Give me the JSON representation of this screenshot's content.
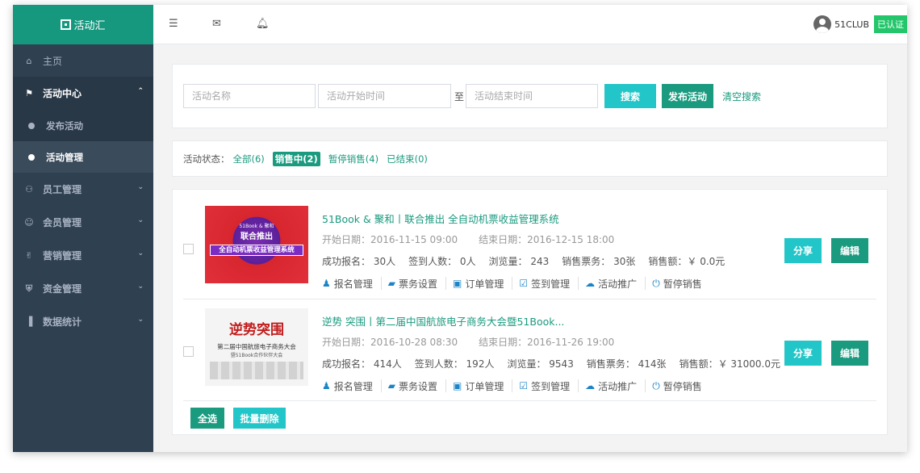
{
  "app": {
    "logo_text": "活动汇"
  },
  "sidebar": {
    "home": "主页",
    "activity_center": "活动中心",
    "sub_items": [
      "发布活动",
      "活动管理"
    ],
    "groups": [
      "员工管理",
      "会员管理",
      "营销管理",
      "资金管理",
      "数据统计"
    ]
  },
  "topbar": {
    "username": "51CLUB",
    "verified": "已认证"
  },
  "search": {
    "name_placeholder": "活动名称",
    "start_placeholder": "活动开始时间",
    "to_label": "至",
    "end_placeholder": "活动结束时间",
    "search_button": "搜索",
    "publish_button": "发布活动",
    "clear_link": "清空搜索"
  },
  "status_filter": {
    "label": "活动状态：",
    "all": "全部(6)",
    "on_sale": "销售中(2)",
    "paused": "暂停销售(4)",
    "ended": "已结束(0)"
  },
  "activities": [
    {
      "title": "51Book & 聚和丨联合推出 全自动机票收益管理系统",
      "start": "开始日期：2016-11-15 09:00",
      "end": "结束日期：2016-12-15 18:00",
      "signups": "成功报名： 30人",
      "checkins": "签到人数： 0人",
      "views": "浏览量： 243",
      "tickets": "销售票务： 30张",
      "revenue": "销售额：￥ 0.0元",
      "thumb": {
        "small": "51Book & 聚和",
        "big": "联合推出",
        "band": "全自动机票收益管理系统"
      }
    },
    {
      "title": "逆势 突围丨第二届中国航旅电子商务大会暨51Book...",
      "start": "开始日期：2016-10-28 08:30",
      "end": "结束日期：2016-11-26 19:00",
      "signups": "成功报名： 414人",
      "checkins": "签到人数： 192人",
      "views": "浏览量： 9543",
      "tickets": "销售票务： 414张",
      "revenue": "销售额：￥ 31000.0元",
      "thumb": {
        "big": "逆势突围",
        "sub": "第二届中国航旅电子商务大会",
        "sub2": "暨51Book合作伙伴大会"
      }
    }
  ],
  "row_actions": [
    "报名管理",
    "票务设置",
    "订单管理",
    "签到管理",
    "活动推广",
    "暂停销售"
  ],
  "row_buttons": {
    "share": "分享",
    "edit": "编辑"
  },
  "bulk": {
    "select_all": "全选",
    "batch_delete": "批量删除"
  },
  "colors": {
    "primary": "#1a9a7f",
    "info": "#23c6c8",
    "sidebar": "#2f4050",
    "icon_blue": "#1c84c6"
  }
}
